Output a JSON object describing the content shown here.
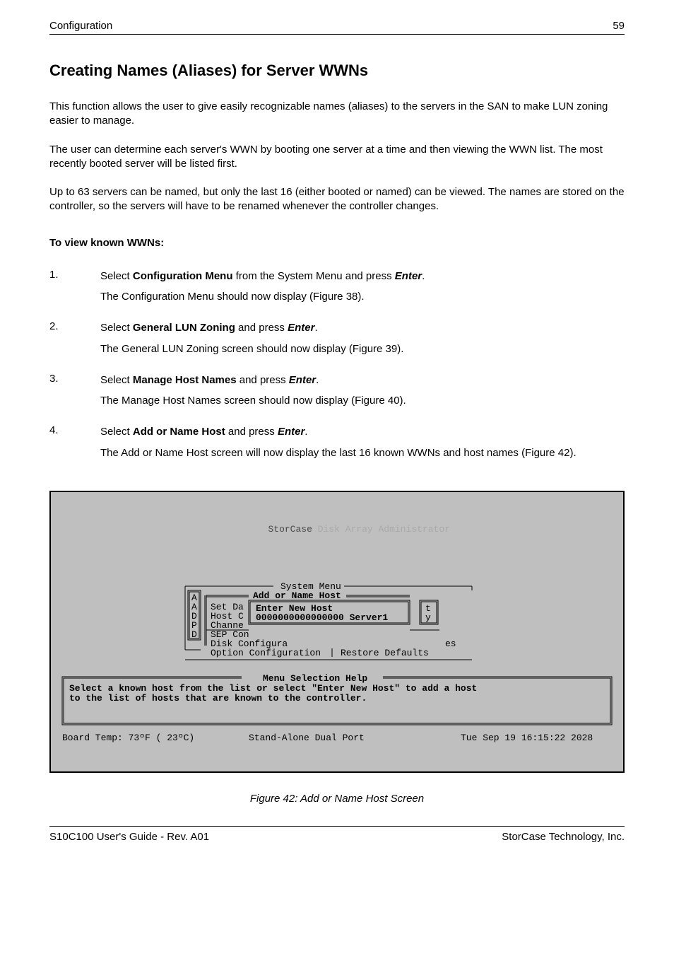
{
  "header": {
    "left": "Configuration",
    "right": "59"
  },
  "title": "Creating Names (Aliases) for Server WWNs",
  "paragraphs": {
    "p1": "This function allows the user to give easily recognizable names (aliases) to the servers in the SAN to make LUN zoning easier to manage.",
    "p2": "The user can determine each server's WWN by booting one server at a time and then viewing the WWN list.  The most recently booted server will be listed first.",
    "p3": "Up to 63 servers can be named, but only the last 16 (either booted or named) can be viewed.  The names are stored on the controller, so the servers will have to be renamed whenever the controller  changes."
  },
  "subhead": "To  view  known  WWNs:",
  "steps": {
    "s1": {
      "num": "1.",
      "pre": "Select ",
      "bold1": "Configuration Menu",
      "mid": " from the System Menu and press ",
      "bi": "Enter",
      "post": ".",
      "note": "The Configuration Menu should now display (Figure 38)."
    },
    "s2": {
      "num": "2.",
      "pre": "Select ",
      "bold1": "General LUN Zoning",
      "mid": " and press ",
      "bi": "Enter",
      "post": ".",
      "note": "The General LUN Zoning screen should now display (Figure 39)."
    },
    "s3": {
      "num": "3.",
      "pre": "Select ",
      "bold1": "Manage Host Names",
      "mid": " and press ",
      "bi": "Enter",
      "post": ".",
      "note": "The Manage Host Names screen should now display (Figure 40)."
    },
    "s4": {
      "num": "4.",
      "pre": "Select ",
      "bold1": "Add or Name Host",
      "mid": " and press ",
      "bi": "Enter",
      "post": ".",
      "note": "The Add or Name Host screen will now display the last 16 known WWNs and host names (Figure 42)."
    }
  },
  "terminal": {
    "title_dark": "StorCase",
    "title_light": " Disk Array Administrator",
    "system_menu_label": "System Menu",
    "add_or_name_label": "Add or Name Host",
    "left_letters": [
      "A",
      "A",
      "D",
      "P",
      "D"
    ],
    "col2": [
      "Set Da",
      "Host C",
      "Channe",
      "SEP Con",
      "Disk Configura",
      "Option Configuration"
    ],
    "inner_lines": [
      "Enter New Host",
      "0000000000000000 Server1"
    ],
    "right_letters": [
      "t",
      "y"
    ],
    "es": "es",
    "restore": "Restore Defaults",
    "help_label": "Menu Selection Help",
    "help_line1": "Select a known host from the list or select \"Enter New Host\" to add a host",
    "help_line2": "to the list of hosts that are known to the controller.",
    "status_left": "Board Temp:  73ºF ( 23ºC)",
    "status_mid": "Stand-Alone Dual Port",
    "status_right": "Tue Sep 19 16:15:22 2028"
  },
  "caption": "Figure 42:  Add or Name Host Screen",
  "footer": {
    "left": "S10C100 User's Guide - Rev. A01",
    "right": "StorCase Technology, Inc."
  }
}
